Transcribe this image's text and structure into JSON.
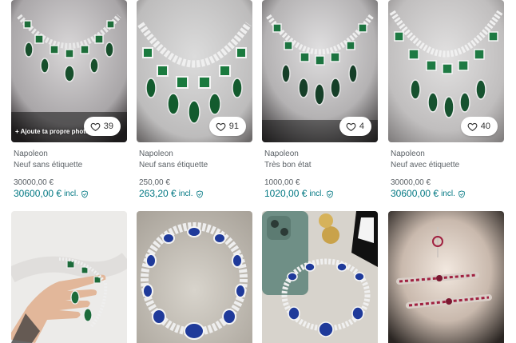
{
  "colors": {
    "accent": "#007782",
    "muted_text": "#5b6166",
    "emerald": "#1d6e3a",
    "sapphire": "#1f3a9a",
    "ruby": "#a02040"
  },
  "listings": [
    {
      "favorites": "39",
      "overlay_label": "+ Ajoute ta propre photo",
      "brand": "Napoleon",
      "condition": "Neuf sans étiquette",
      "price": "30000,00 €",
      "price_incl": "30600,00 €",
      "incl_label": "incl."
    },
    {
      "favorites": "91",
      "brand": "Napoleon",
      "condition": "Neuf sans étiquette",
      "price": "250,00 €",
      "price_incl": "263,20 €",
      "incl_label": "incl."
    },
    {
      "favorites": "4",
      "brand": "Napoleon",
      "condition": "Très bon état",
      "price": "1000,00 €",
      "price_incl": "1020,00 €",
      "incl_label": "incl."
    },
    {
      "favorites": "40",
      "brand": "Napoleon",
      "condition": "Neuf avec étiquette",
      "price": "30000,00 €",
      "price_incl": "30600,00 €",
      "incl_label": "incl."
    }
  ],
  "icons": {
    "favorite": "heart-icon",
    "buyer_protection": "shield-check-icon"
  }
}
